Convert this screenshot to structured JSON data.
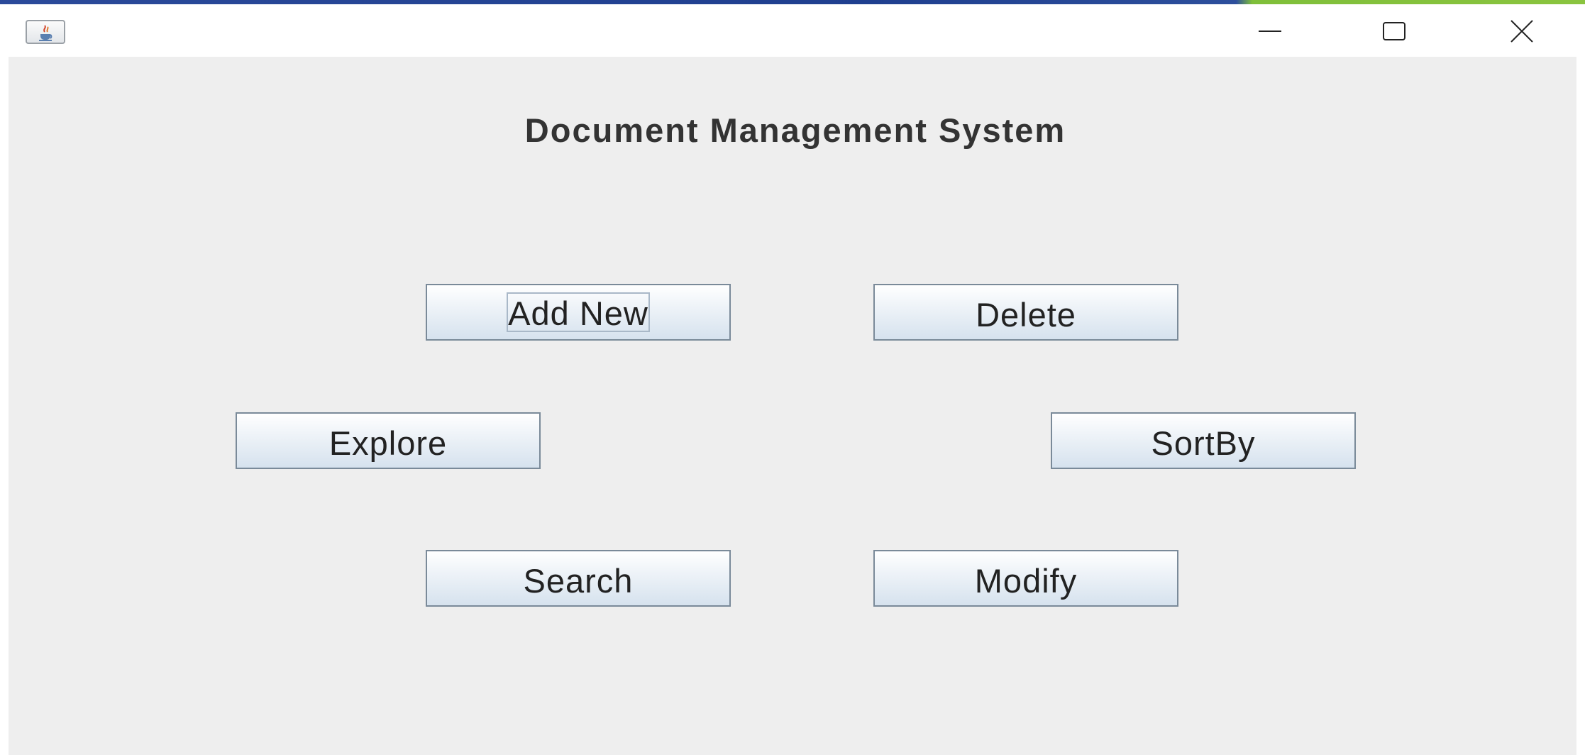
{
  "window": {
    "title": "",
    "app_icon": "java-cup-icon",
    "controls": {
      "minimize_icon": "minimize-icon",
      "maximize_icon": "maximize-icon",
      "close_icon": "close-icon"
    }
  },
  "main": {
    "heading": "Document Management System",
    "buttons": {
      "add_new": "Add New",
      "delete": "Delete",
      "explore": "Explore",
      "sort_by": "SortBy",
      "search": "Search",
      "modify": "Modify"
    }
  },
  "colors": {
    "client_background": "#eeeeee",
    "button_border": "#7a8a99",
    "button_gradient_bottom": "#d6e2ee",
    "text": "#222222"
  }
}
